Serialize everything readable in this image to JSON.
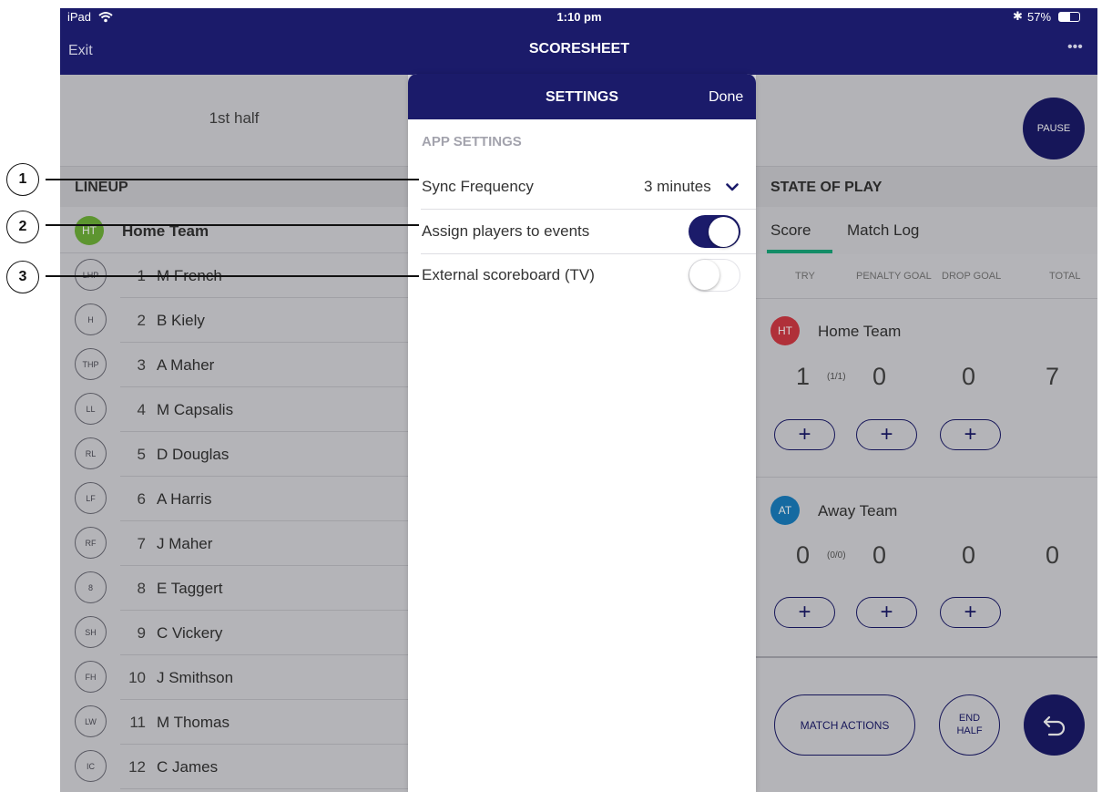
{
  "status_bar": {
    "device": "iPad",
    "time": "1:10 pm",
    "battery": "57%"
  },
  "nav": {
    "exit": "Exit",
    "title": "SCORESHEET",
    "more": "•••"
  },
  "left": {
    "half_label": "1st half",
    "lineup_title": "LINEUP",
    "team": {
      "badge": "HT",
      "name": "Home Team",
      "color": "#6fb23a"
    },
    "players": [
      {
        "pos": "LHP",
        "num": "1",
        "name": "M French"
      },
      {
        "pos": "H",
        "num": "2",
        "name": "B Kiely"
      },
      {
        "pos": "THP",
        "num": "3",
        "name": "A Maher"
      },
      {
        "pos": "LL",
        "num": "4",
        "name": "M Capsalis"
      },
      {
        "pos": "RL",
        "num": "5",
        "name": "D Douglas"
      },
      {
        "pos": "LF",
        "num": "6",
        "name": "A Harris"
      },
      {
        "pos": "RF",
        "num": "7",
        "name": "J Maher"
      },
      {
        "pos": "8",
        "num": "8",
        "name": "E Taggert"
      },
      {
        "pos": "SH",
        "num": "9",
        "name": "C Vickery"
      },
      {
        "pos": "FH",
        "num": "10",
        "name": "J Smithson"
      },
      {
        "pos": "LW",
        "num": "11",
        "name": "M Thomas"
      },
      {
        "pos": "IC",
        "num": "12",
        "name": "C James"
      }
    ]
  },
  "right": {
    "pause": "PAUSE",
    "state_title": "STATE OF PLAY",
    "tabs": [
      "Score",
      "Match Log"
    ],
    "columns": [
      "TRY",
      "PENALTY GOAL",
      "DROP GOAL",
      "TOTAL"
    ],
    "teams": [
      {
        "badge": "HT",
        "name": "Home Team",
        "color": "#d23a44",
        "try": "1",
        "try_detail": "(1/1)",
        "penalty": "0",
        "drop": "0",
        "total": "7"
      },
      {
        "badge": "AT",
        "name": "Away Team",
        "color": "#1a7fc0",
        "try": "0",
        "try_detail": "(0/0)",
        "penalty": "0",
        "drop": "0",
        "total": "0"
      }
    ],
    "plus": "+",
    "match_actions": "MATCH ACTIONS",
    "end_half": [
      "END",
      "HALF"
    ]
  },
  "modal": {
    "title": "SETTINGS",
    "done": "Done",
    "section": "APP SETTINGS",
    "sync_label": "Sync Frequency",
    "sync_value": "3 minutes",
    "assign_label": "Assign players to events",
    "assign_on": true,
    "external_label": "External scoreboard (TV)",
    "external_on": false,
    "accent": "#1b1b6a"
  },
  "callouts": [
    "1",
    "2",
    "3"
  ]
}
